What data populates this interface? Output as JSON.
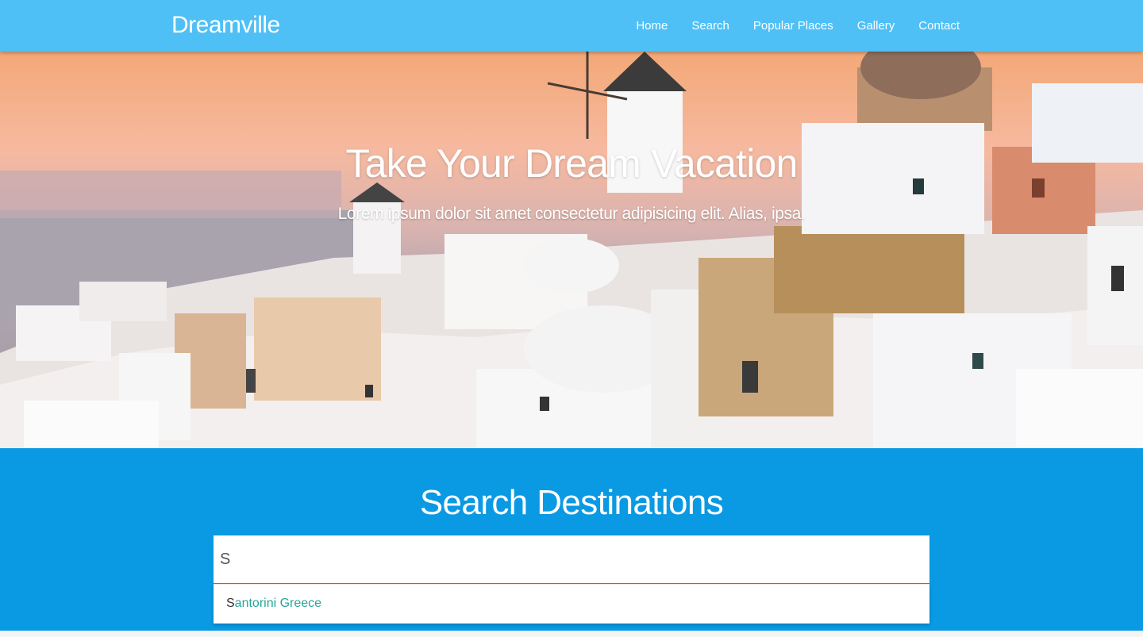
{
  "navbar": {
    "brand": "Dreamville",
    "links": [
      {
        "label": "Home"
      },
      {
        "label": "Search"
      },
      {
        "label": "Popular Places"
      },
      {
        "label": "Gallery"
      },
      {
        "label": "Contact"
      }
    ]
  },
  "hero": {
    "title": "Take Your Dream Vacation",
    "subtitle": "Lorem ipsum dolor sit amet consectetur adipisicing elit. Alias, ipsa."
  },
  "search": {
    "title": "Search Destinations",
    "input_value": "S",
    "suggestion_match": "S",
    "suggestion_rest": "antorini Greece"
  },
  "colors": {
    "navbar": "#4fc0f6",
    "search_section": "#0a99e3",
    "suggestion_text": "#26a69a"
  }
}
